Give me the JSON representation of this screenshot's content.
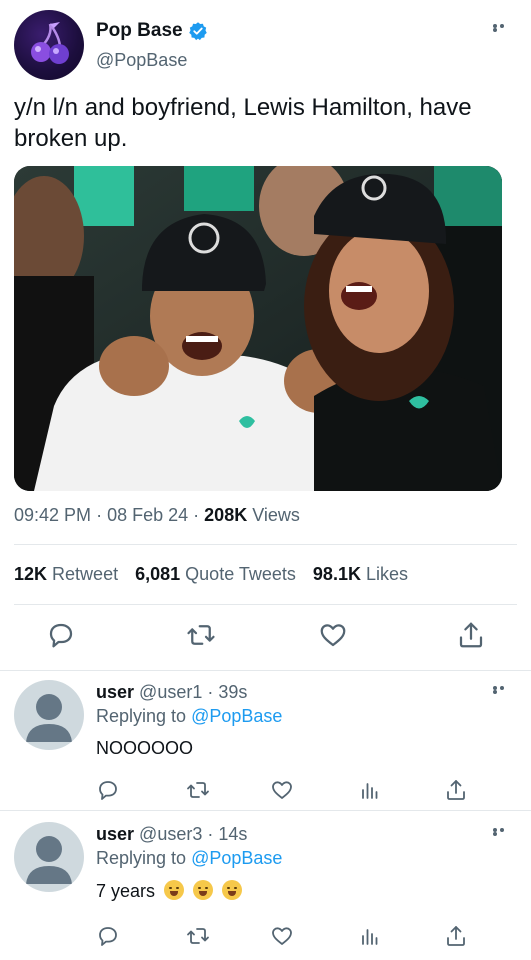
{
  "tweet": {
    "display_name": "Pop Base",
    "handle": "@PopBase",
    "text": "y/n l/n and boyfriend, Lewis Hamilton, have broken up.",
    "time": "09:42 PM",
    "sep1": "·",
    "date": "08 Feb 24",
    "sep2": "·",
    "views_count": "208K",
    "views_label": "Views",
    "retweets_count": "12K",
    "retweets_label": "Retweet",
    "quotes_count": "6,081",
    "quotes_label": "Quote Tweets",
    "likes_count": "98.1K",
    "likes_label": "Likes"
  },
  "replies": [
    {
      "username": "user",
      "handle": "@user1",
      "sep": "·",
      "time": "39s",
      "replying_prefix": "Replying to",
      "replying_to": "@PopBase",
      "text": "NOOOOOO"
    },
    {
      "username": "user",
      "handle": "@user3",
      "sep": "·",
      "time": "14s",
      "replying_prefix": "Replying to",
      "replying_to": "@PopBase",
      "text": "7 years"
    }
  ],
  "icons": {
    "verified": "verified-badge-icon",
    "more": "more-icon",
    "reply": "reply-icon",
    "retweet": "retweet-icon",
    "like": "heart-icon",
    "share": "share-icon",
    "analytics": "analytics-icon"
  },
  "colors": {
    "accent": "#1d9bf0",
    "text_primary": "#0f1419",
    "text_secondary": "#536471",
    "divider": "#e4e8eb"
  }
}
